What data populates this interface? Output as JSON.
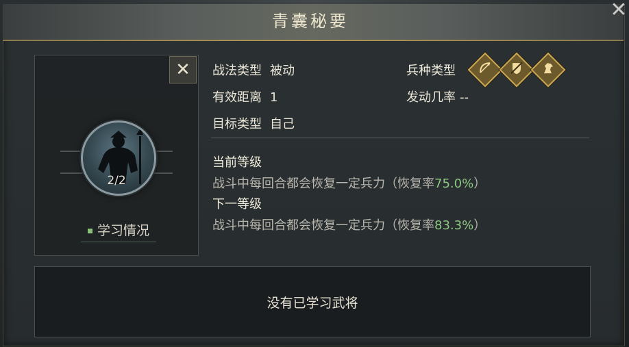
{
  "window": {
    "title": "青囊秘要"
  },
  "controls": {
    "close_symbol": "✕",
    "corner_close_symbol": "✕"
  },
  "skill": {
    "tactic_type_label": "战法类型",
    "tactic_type_value": "被动",
    "range_label": "有效距离",
    "range_value": "1",
    "target_label": "目标类型",
    "target_value": "自己",
    "troop_type_label": "兵种类型",
    "trigger_rate_label": "发动几率",
    "trigger_rate_value": "--",
    "troop_icons": [
      "archer-icon",
      "infantry-icon",
      "cavalry-icon"
    ]
  },
  "learning": {
    "progress": "2/2",
    "status_link": "学习情况",
    "empty_message": "没有已学习武将"
  },
  "levels": {
    "current_title": "当前等级",
    "current_desc": "战斗中每回合都会恢复一定兵力（恢复率",
    "current_rate": "75.0%",
    "current_end": "）",
    "next_title": "下一等级",
    "next_desc": "战斗中每回合都会恢复一定兵力（恢复率",
    "next_rate": "83.3%",
    "next_end": "）"
  },
  "colors": {
    "accent_gold": "#c9a652",
    "rate_green": "#8ec784",
    "panel_bg": "#272c2e"
  }
}
